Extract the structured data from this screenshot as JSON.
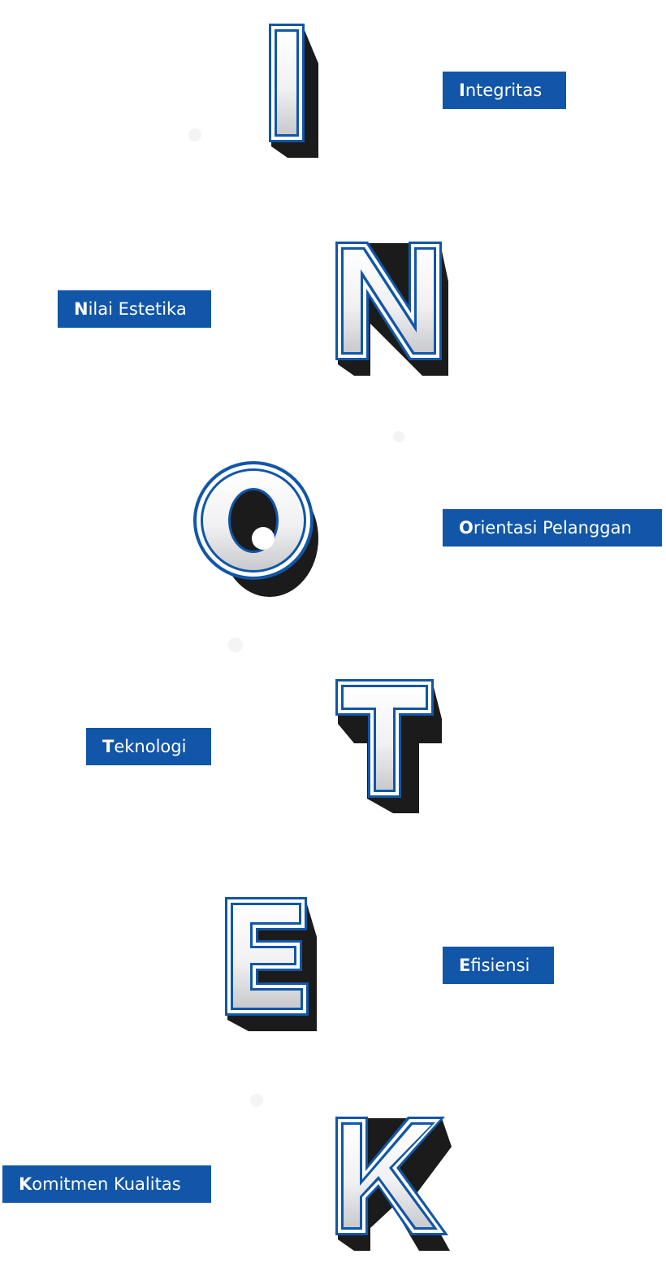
{
  "colors": {
    "accent_blue": "#1156a8",
    "letter_fill_top": "#ffffff",
    "letter_fill_bottom": "#c8c9cc",
    "letter_shadow": "#1b1b1b",
    "label_text": "#ffffff"
  },
  "values": [
    {
      "letter": "I",
      "label_initial": "I",
      "label_rest": "ntegritas"
    },
    {
      "letter": "N",
      "label_initial": "N",
      "label_rest": "ilai Estetika"
    },
    {
      "letter": "O",
      "label_initial": "O",
      "label_rest": "rientasi Pelanggan"
    },
    {
      "letter": "T",
      "label_initial": "T",
      "label_rest": "eknologi"
    },
    {
      "letter": "E",
      "label_initial": "E",
      "label_rest": "fisiensi"
    },
    {
      "letter": "K",
      "label_initial": "K",
      "label_rest": "omitmen Kualitas"
    }
  ]
}
